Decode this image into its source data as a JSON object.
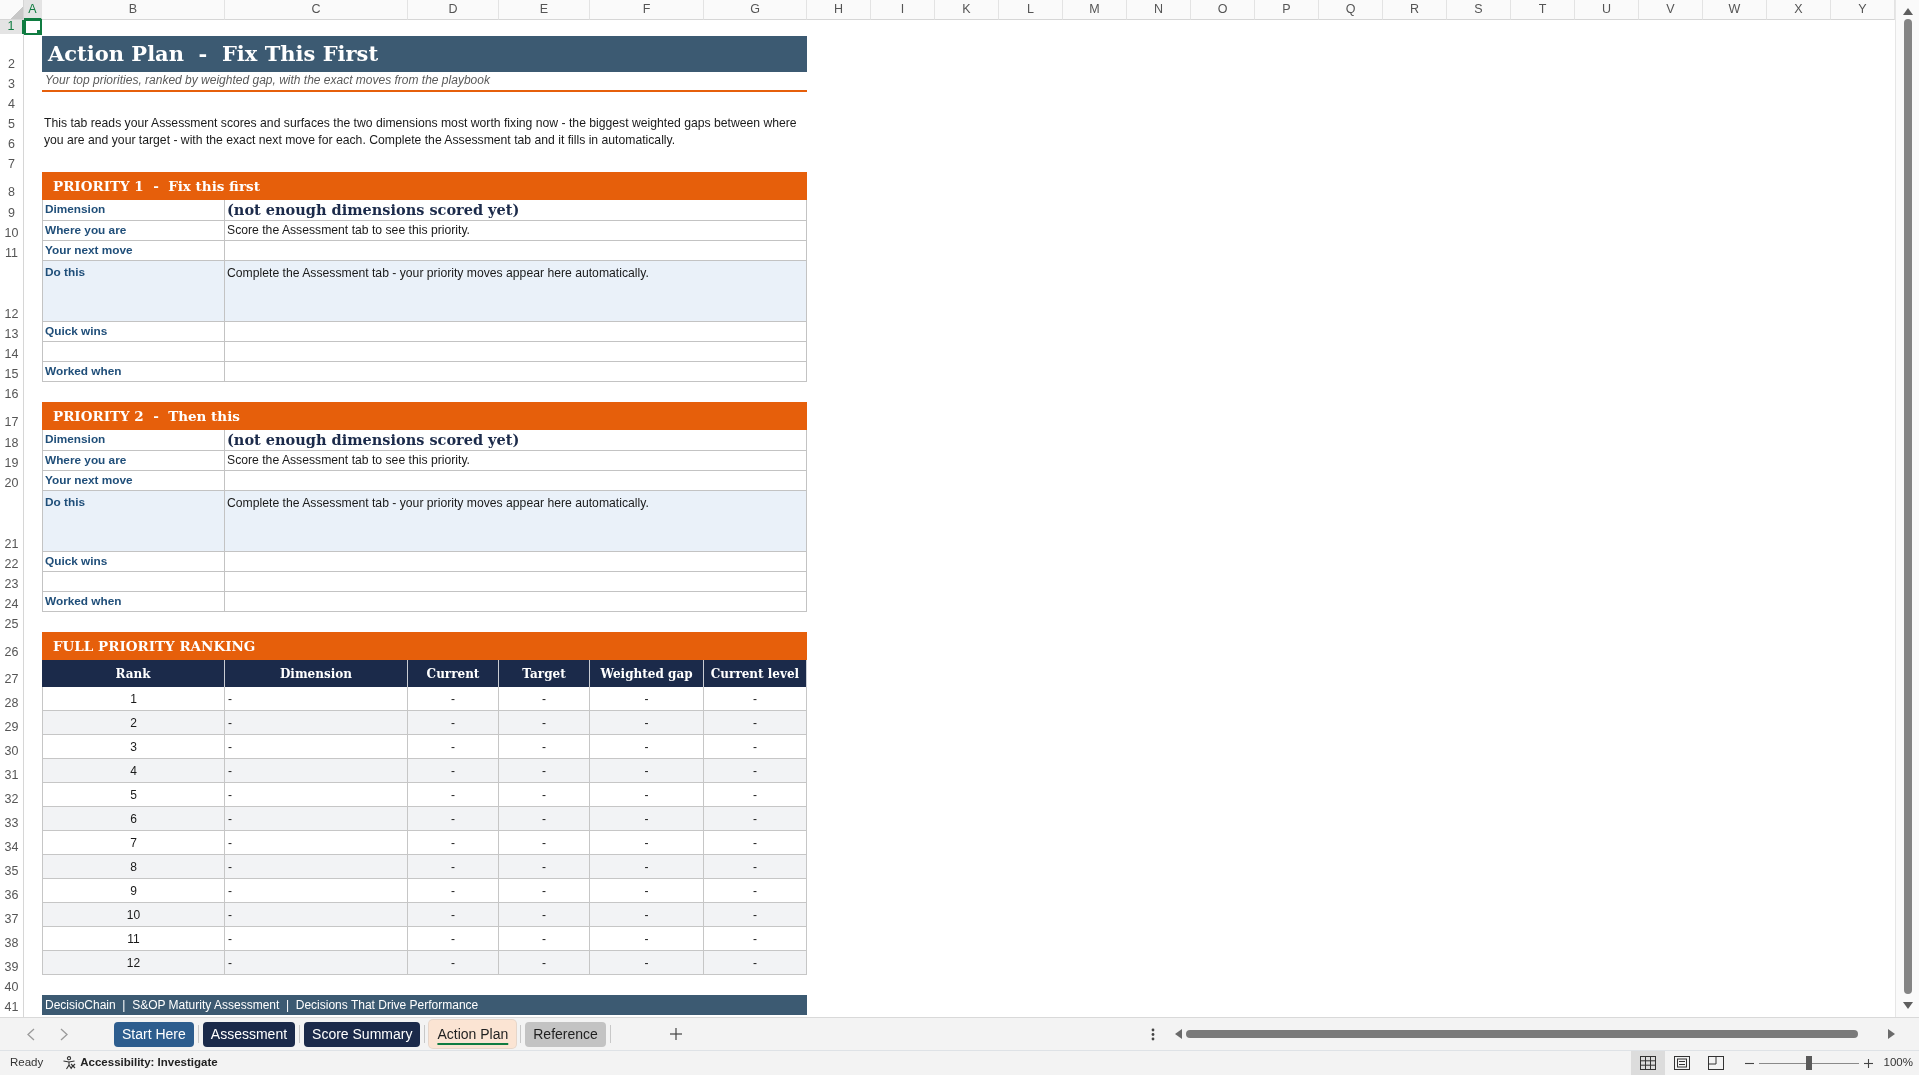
{
  "sheet": {
    "column_headers": [
      {
        "label": "A",
        "selected": true
      },
      {
        "label": "B",
        "selected": false
      },
      {
        "label": "C",
        "selected": false
      },
      {
        "label": "D",
        "selected": false
      },
      {
        "label": "E",
        "selected": false
      },
      {
        "label": "F",
        "selected": false
      },
      {
        "label": "G",
        "selected": false
      },
      {
        "label": "H",
        "selected": false
      },
      {
        "label": "I",
        "selected": false
      },
      {
        "label": "K",
        "selected": false
      },
      {
        "label": "L",
        "selected": false
      },
      {
        "label": "M",
        "selected": false
      },
      {
        "label": "N",
        "selected": false
      },
      {
        "label": "O",
        "selected": false
      },
      {
        "label": "P",
        "selected": false
      },
      {
        "label": "Q",
        "selected": false
      },
      {
        "label": "R",
        "selected": false
      },
      {
        "label": "S",
        "selected": false
      },
      {
        "label": "T",
        "selected": false
      },
      {
        "label": "U",
        "selected": false
      },
      {
        "label": "V",
        "selected": false
      },
      {
        "label": "W",
        "selected": false
      },
      {
        "label": "X",
        "selected": false
      },
      {
        "label": "Y",
        "selected": false
      }
    ],
    "row_headers": [
      {
        "label": "1",
        "selected": true
      },
      {
        "label": "2",
        "selected": false
      },
      {
        "label": "3",
        "selected": false
      },
      {
        "label": "4",
        "selected": false
      },
      {
        "label": "5",
        "selected": false
      },
      {
        "label": "6",
        "selected": false
      },
      {
        "label": "7",
        "selected": false
      },
      {
        "label": "8",
        "selected": false
      },
      {
        "label": "9",
        "selected": false
      },
      {
        "label": "10",
        "selected": false
      },
      {
        "label": "11",
        "selected": false
      },
      {
        "label": "12",
        "selected": false
      },
      {
        "label": "13",
        "selected": false
      },
      {
        "label": "14",
        "selected": false
      },
      {
        "label": "15",
        "selected": false
      },
      {
        "label": "16",
        "selected": false
      },
      {
        "label": "17",
        "selected": false
      },
      {
        "label": "18",
        "selected": false
      },
      {
        "label": "19",
        "selected": false
      },
      {
        "label": "20",
        "selected": false
      },
      {
        "label": "21",
        "selected": false
      },
      {
        "label": "22",
        "selected": false
      },
      {
        "label": "23",
        "selected": false
      },
      {
        "label": "24",
        "selected": false
      },
      {
        "label": "25",
        "selected": false
      },
      {
        "label": "26",
        "selected": false
      },
      {
        "label": "27",
        "selected": false
      },
      {
        "label": "28",
        "selected": false
      },
      {
        "label": "29",
        "selected": false
      },
      {
        "label": "30",
        "selected": false
      },
      {
        "label": "31",
        "selected": false
      },
      {
        "label": "32",
        "selected": false
      },
      {
        "label": "33",
        "selected": false
      },
      {
        "label": "34",
        "selected": false
      },
      {
        "label": "35",
        "selected": false
      },
      {
        "label": "36",
        "selected": false
      },
      {
        "label": "37",
        "selected": false
      },
      {
        "label": "38",
        "selected": false
      },
      {
        "label": "39",
        "selected": false
      },
      {
        "label": "40",
        "selected": false
      },
      {
        "label": "41",
        "selected": false
      }
    ]
  },
  "title": "Action Plan  -  Fix This First",
  "subtitle": "Your top priorities, ranked by weighted gap, with the exact moves from the playbook",
  "intro": "This tab reads your Assessment scores and surfaces the two dimensions most worth fixing now - the biggest weighted gaps between where you are and your target - with the exact next move for each. Complete the Assessment tab and it fills in automatically.",
  "priorities": [
    {
      "heading": "PRIORITY 1  -  Fix this first",
      "fields": [
        {
          "kind": "headline",
          "label": "Dimension",
          "value": "(not enough dimensions scored yet)"
        },
        {
          "kind": "line",
          "label": "Where you are",
          "value": "Score the Assessment tab to see this priority."
        },
        {
          "kind": "line",
          "label": "Your next move"
        },
        {
          "kind": "block",
          "label": "Do this",
          "value": "Complete the Assessment tab - your priority moves appear here automatically."
        },
        {
          "kind": "line",
          "label": "Quick wins"
        },
        {
          "kind": "line"
        },
        {
          "kind": "line",
          "label": "Worked when"
        }
      ]
    },
    {
      "heading": "PRIORITY 2  -  Then this",
      "fields": [
        {
          "kind": "headline",
          "label": "Dimension",
          "value": "(not enough dimensions scored yet)"
        },
        {
          "kind": "line",
          "label": "Where you are",
          "value": "Score the Assessment tab to see this priority."
        },
        {
          "kind": "line",
          "label": "Your next move"
        },
        {
          "kind": "block",
          "label": "Do this",
          "value": "Complete the Assessment tab - your priority moves appear here automatically."
        },
        {
          "kind": "line",
          "label": "Quick wins"
        },
        {
          "kind": "line"
        },
        {
          "kind": "line",
          "label": "Worked when"
        }
      ]
    }
  ],
  "ranking": {
    "heading": "FULL PRIORITY RANKING",
    "columns": [
      "Rank",
      "Dimension",
      "Current",
      "Target",
      "Weighted gap",
      "Current level"
    ],
    "rows": [
      [
        "1",
        "-",
        "-",
        "-",
        "-",
        "-"
      ],
      [
        "2",
        "-",
        "-",
        "-",
        "-",
        "-"
      ],
      [
        "3",
        "-",
        "-",
        "-",
        "-",
        "-"
      ],
      [
        "4",
        "-",
        "-",
        "-",
        "-",
        "-"
      ],
      [
        "5",
        "-",
        "-",
        "-",
        "-",
        "-"
      ],
      [
        "6",
        "-",
        "-",
        "-",
        "-",
        "-"
      ],
      [
        "7",
        "-",
        "-",
        "-",
        "-",
        "-"
      ],
      [
        "8",
        "-",
        "-",
        "-",
        "-",
        "-"
      ],
      [
        "9",
        "-",
        "-",
        "-",
        "-",
        "-"
      ],
      [
        "10",
        "-",
        "-",
        "-",
        "-",
        "-"
      ],
      [
        "11",
        "-",
        "-",
        "-",
        "-",
        "-"
      ],
      [
        "12",
        "-",
        "-",
        "-",
        "-",
        "-"
      ]
    ]
  },
  "footer": "DecisioChain  |  S&OP Maturity Assessment  |  Decisions That Drive Performance",
  "sheet_tabs": [
    {
      "label": "Start Here",
      "color": "#2d5d8e",
      "selected": false
    },
    {
      "label": "Assessment",
      "color": "#1b2a4a",
      "selected": false
    },
    {
      "label": "Score Summary",
      "color": "#1b2a4a",
      "selected": false
    },
    {
      "label": "Action Plan",
      "color": "#fbe4d3",
      "selected": true
    },
    {
      "label": "Reference",
      "color": "#c3c3c3",
      "selected": false
    }
  ],
  "status_bar": {
    "mode": "Ready",
    "accessibility": "Accessibility: Investigate",
    "views": [
      {
        "kind": "normal",
        "selected": true
      },
      {
        "kind": "page_layout",
        "selected": false
      },
      {
        "kind": "page_break_preview",
        "selected": false
      }
    ],
    "zoom_slider": {
      "level": 0.5
    },
    "zoom": "100%"
  }
}
